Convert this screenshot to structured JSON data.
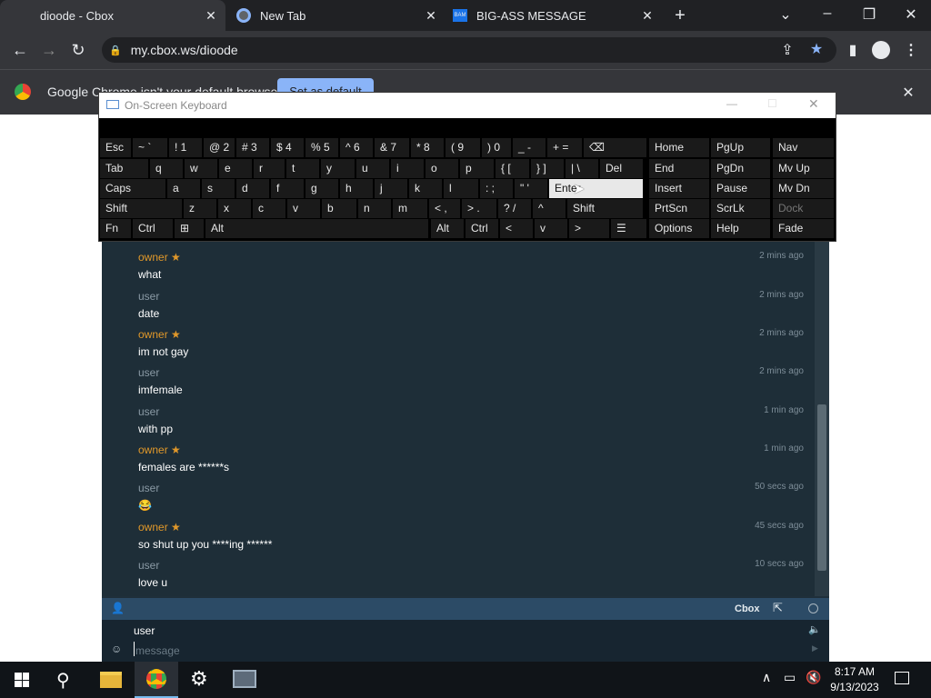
{
  "browser": {
    "tabs": [
      {
        "title": "dioode - Cbox"
      },
      {
        "title": "New Tab"
      },
      {
        "title": "BIG-ASS MESSAGE"
      }
    ],
    "url": "my.cbox.ws/dioode",
    "infobar": {
      "text": "Google Chrome isn't your default browser",
      "button": "Set as default"
    }
  },
  "osk": {
    "title": "On-Screen Keyboard",
    "rows": [
      [
        "Esc",
        "~ `",
        "! 1",
        "@ 2",
        "# 3",
        "$ 4",
        "% 5",
        "^ 6",
        "& 7",
        "* 8",
        "( 9",
        ") 0",
        "_ -",
        "+ =",
        "⌫",
        "Home",
        "PgUp",
        "Nav"
      ],
      [
        "Tab",
        "q",
        "w",
        "e",
        "r",
        "t",
        "y",
        "u",
        "i",
        "o",
        "p",
        "{ [",
        "} ]",
        "| \\",
        "Del",
        "End",
        "PgDn",
        "Mv Up"
      ],
      [
        "Caps",
        "a",
        "s",
        "d",
        "f",
        "g",
        "h",
        "j",
        "k",
        "l",
        ": ;",
        "\" '",
        "Enter",
        "Insert",
        "Pause",
        "Mv Dn"
      ],
      [
        "Shift",
        "z",
        "x",
        "c",
        "v",
        "b",
        "n",
        "m",
        "< ,",
        "> .",
        "? /",
        "^",
        "Shift",
        "PrtScn",
        "ScrLk",
        "Dock"
      ],
      [
        "Fn",
        "Ctrl",
        "⊞",
        "Alt",
        "Alt",
        "Ctrl",
        "<",
        "v",
        ">",
        "☰",
        "Options",
        "Help",
        "Fade"
      ]
    ]
  },
  "chat": {
    "messages": [
      {
        "user": "owner ★",
        "role": "owner",
        "text": "what",
        "time": "2 mins ago"
      },
      {
        "user": "user",
        "role": "user",
        "text": "date",
        "time": "2 mins ago"
      },
      {
        "user": "owner ★",
        "role": "owner",
        "text": "im not gay",
        "time": "2 mins ago"
      },
      {
        "user": "user",
        "role": "user",
        "text": "imfemale",
        "time": "2 mins ago"
      },
      {
        "user": "user",
        "role": "user",
        "text": "with pp",
        "time": "1 min ago"
      },
      {
        "user": "owner ★",
        "role": "owner",
        "text": "females are ******s",
        "time": "1 min ago"
      },
      {
        "user": "user",
        "role": "user",
        "text": "😂",
        "time": "50 secs ago"
      },
      {
        "user": "owner ★",
        "role": "owner",
        "text": "so shut up you ****ing ******",
        "time": "45 secs ago"
      },
      {
        "user": "user",
        "role": "user",
        "text": "love u",
        "time": "10 secs ago"
      }
    ],
    "brand": "Cbox",
    "name_field": "user",
    "message_placeholder": "message"
  },
  "taskbar": {
    "time": "8:17 AM",
    "date": "9/13/2023"
  }
}
